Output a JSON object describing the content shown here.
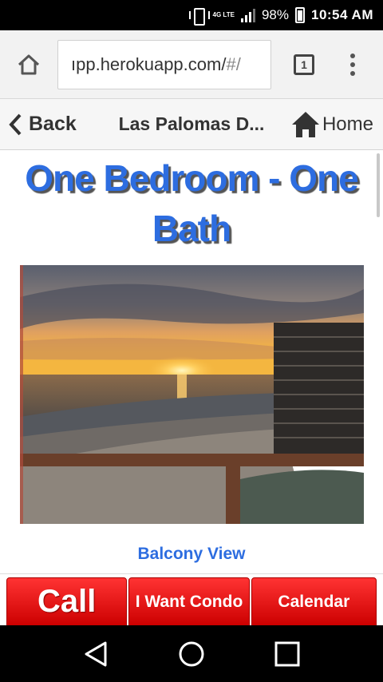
{
  "status_bar": {
    "network_label": "4G LTE",
    "battery_percent": "98%",
    "time": "10:54 AM",
    "icons": [
      "vibrate-icon",
      "signal-icon",
      "battery-icon"
    ]
  },
  "browser": {
    "url_main": "ıpp.herokuapp.com/",
    "url_faded": "#/",
    "tab_count": "1",
    "icons": [
      "home-icon",
      "tabs-icon",
      "overflow-menu-icon"
    ]
  },
  "app_nav": {
    "back_label": "Back",
    "title": "Las Palomas D...",
    "home_label": "Home",
    "icons": [
      "chevron-left-icon",
      "house-icon"
    ]
  },
  "content": {
    "title": "One Bedroom - One Bath",
    "photo_caption": "Balcony View"
  },
  "actions": {
    "call_label": "Call",
    "want_label": "I Want Condo",
    "calendar_label": "Calendar"
  },
  "android_nav": {
    "icons": [
      "back-triangle-icon",
      "home-circle-icon",
      "recents-square-icon"
    ]
  },
  "colors": {
    "title_blue": "#2d6de0",
    "button_red": "#e60000"
  }
}
